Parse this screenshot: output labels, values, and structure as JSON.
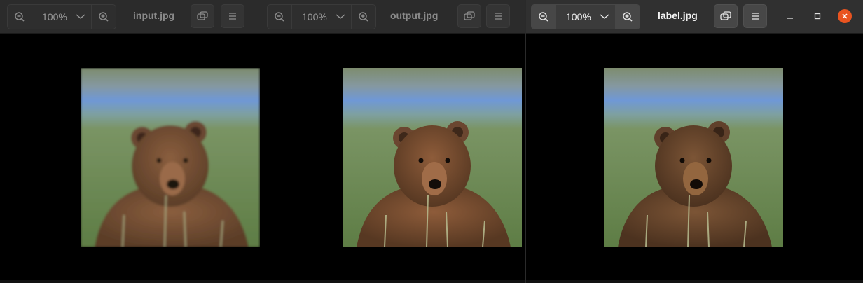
{
  "windows": [
    {
      "title": "input.jpg",
      "zoom": "100%",
      "active": false,
      "icons": {
        "zoom_out": "zoom-out-icon",
        "zoom_dropdown": "chevron-down-icon",
        "zoom_in": "zoom-in-icon",
        "fit": "fit-to-window-icon",
        "menu": "hamburger-menu-icon"
      },
      "image": {
        "subject": "brown bear in grass",
        "filter": "soft"
      }
    },
    {
      "title": "output.jpg",
      "zoom": "100%",
      "active": false,
      "icons": {
        "zoom_out": "zoom-out-icon",
        "zoom_dropdown": "chevron-down-icon",
        "zoom_in": "zoom-in-icon",
        "fit": "fit-to-window-icon",
        "menu": "hamburger-menu-icon"
      },
      "image": {
        "subject": "brown bear in grass",
        "filter": "sharp"
      }
    },
    {
      "title": "label.jpg",
      "zoom": "100%",
      "active": true,
      "icons": {
        "zoom_out": "zoom-out-icon",
        "zoom_dropdown": "chevron-down-icon",
        "zoom_in": "zoom-in-icon",
        "fit": "fit-to-window-icon",
        "menu": "hamburger-menu-icon",
        "minimize": "minimize-icon",
        "maximize": "maximize-icon",
        "close": "close-icon"
      },
      "image": {
        "subject": "brown bear in grass",
        "filter": "sharp"
      }
    }
  ],
  "colors": {
    "accent_close": "#e95420",
    "headerbar_inactive": "#2b2b2b",
    "headerbar_active": "#303030",
    "viewer_background": "#000000"
  }
}
